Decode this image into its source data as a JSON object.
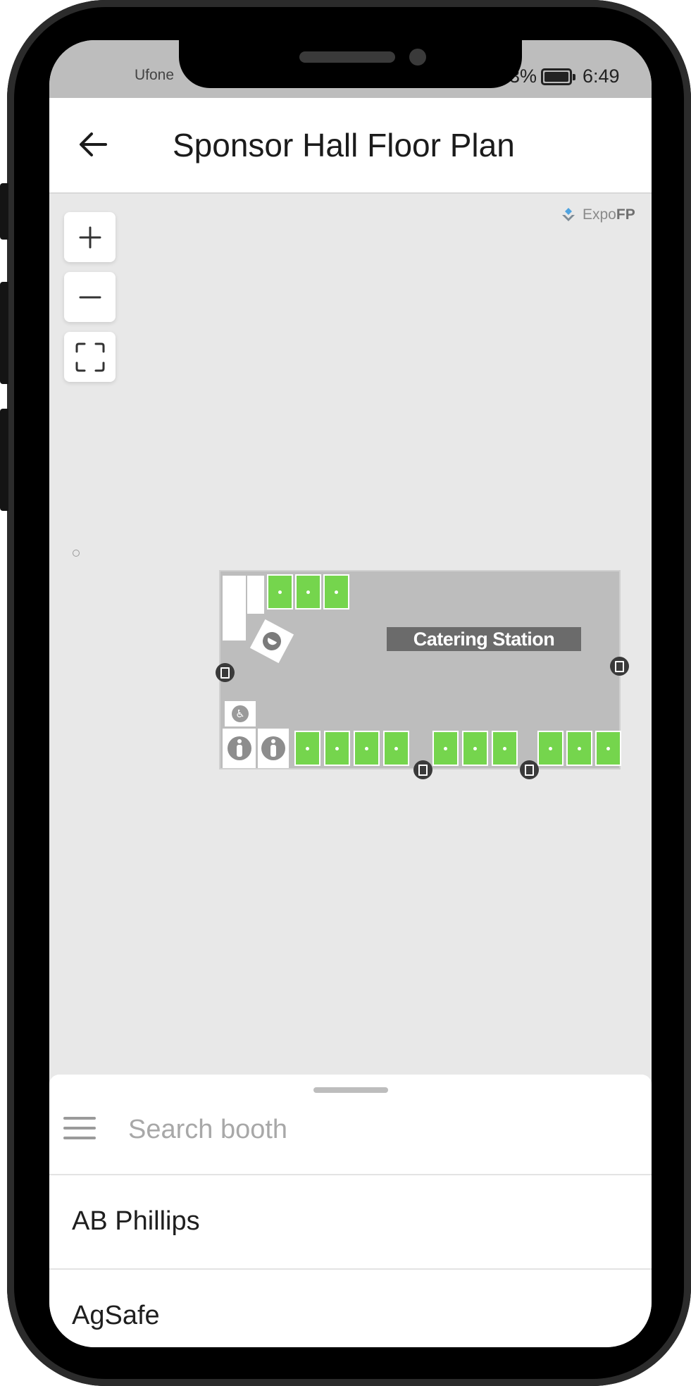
{
  "status_bar": {
    "carrier": "Ufone",
    "battery_percent": "3%",
    "time": "6:49"
  },
  "header": {
    "title": "Sponsor Hall Floor Plan",
    "back_icon": "arrow-left-icon"
  },
  "map": {
    "brand_prefix": "Expo",
    "brand_suffix": "FP",
    "controls": {
      "zoom_in_icon": "plus-icon",
      "zoom_out_icon": "minus-icon",
      "fit_icon": "fullscreen-icon"
    },
    "floor_plan": {
      "area_label": "Catering Station",
      "booth_color": "#75d54d",
      "hall_color": "#bdbdbd"
    }
  },
  "bottom_sheet": {
    "search_placeholder": "Search booth",
    "exhibitors": [
      {
        "name": "AB Phillips"
      },
      {
        "name": "AgSafe"
      }
    ]
  }
}
